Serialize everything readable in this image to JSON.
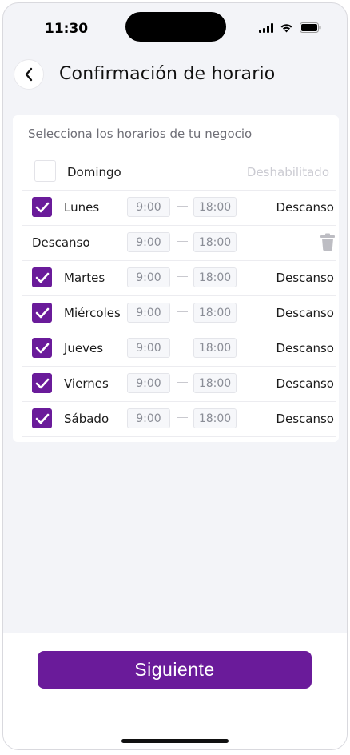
{
  "status_bar": {
    "time": "11:30"
  },
  "header": {
    "title": "Confirmación de horario"
  },
  "card": {
    "subtitle": "Selecciona los horarios de tu negocio",
    "sunday": {
      "label": "Domingo",
      "status": "Deshabilitado"
    },
    "days": [
      {
        "label": "Lunes",
        "from": "9:00",
        "to": "18:00",
        "action": "Descanso"
      },
      {
        "label": "Martes",
        "from": "9:00",
        "to": "18:00",
        "action": "Descanso"
      },
      {
        "label": "Miércoles",
        "from": "9:00",
        "to": "18:00",
        "action": "Descanso"
      },
      {
        "label": "Jueves",
        "from": "9:00",
        "to": "18:00",
        "action": "Descanso"
      },
      {
        "label": "Viernes",
        "from": "9:00",
        "to": "18:00",
        "action": "Descanso"
      },
      {
        "label": "Sábado",
        "from": "9:00",
        "to": "18:00",
        "action": "Descanso"
      }
    ],
    "break_row": {
      "label": "Descanso",
      "from": "9:00",
      "to": "18:00"
    }
  },
  "footer": {
    "next_label": "Siguiente"
  },
  "colors": {
    "accent": "#6a1b9a",
    "background": "#f3f4f8"
  }
}
